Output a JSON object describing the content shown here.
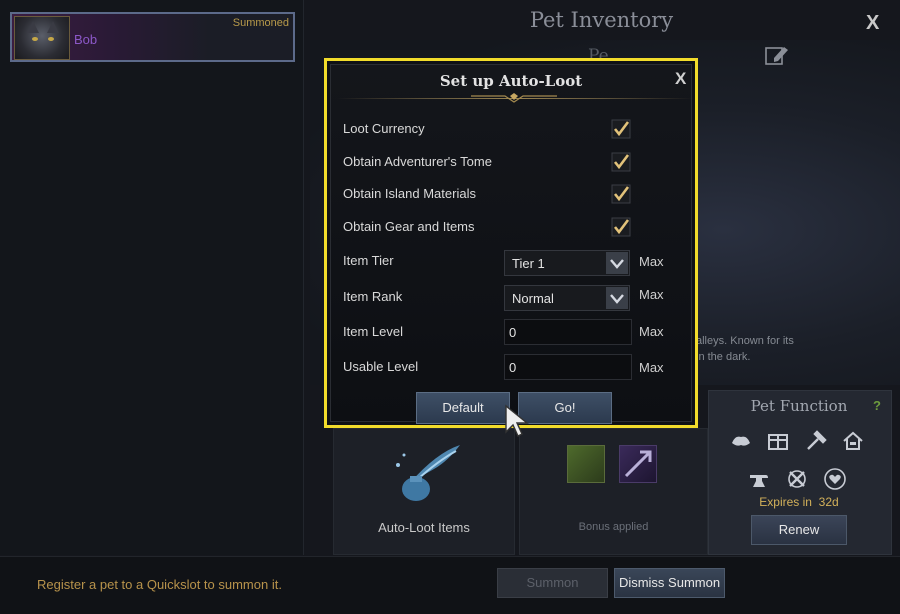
{
  "window": {
    "title": "Pet Inventory",
    "subtitle": "Pe",
    "close_glyph": "X"
  },
  "pet_list": [
    {
      "name": "Bob",
      "status": "Summoned"
    }
  ],
  "pet_description": "alleys. Known for its\nin the dark.",
  "dialog": {
    "title": "Set up Auto-Loot",
    "close_glyph": "X",
    "options": [
      {
        "label": "Loot Currency",
        "checked": true
      },
      {
        "label": "Obtain Adventurer's Tome",
        "checked": true
      },
      {
        "label": "Obtain Island Materials",
        "checked": true
      },
      {
        "label": "Obtain Gear and Items",
        "checked": true
      }
    ],
    "item_tier": {
      "label": "Item Tier",
      "value": "Tier 1",
      "max_label": "Max"
    },
    "item_rank": {
      "label": "Item Rank",
      "value": "Normal",
      "max_label": "Max"
    },
    "item_level": {
      "label": "Item Level",
      "value": "0",
      "max_label": "Max"
    },
    "usable_level": {
      "label": "Usable Level",
      "value": "0",
      "max_label": "Max"
    },
    "default_button": "Default",
    "go_button": "Go!"
  },
  "panels": {
    "auto_loot": {
      "label": "Auto-Loot Items",
      "icon": "auto-loot-bag-icon"
    },
    "bonus": {
      "label": "Bonus applied"
    },
    "pet_function": {
      "title": "Pet Function",
      "help_glyph": "?",
      "icons": [
        "storage-icon",
        "chest-icon",
        "hammer-icon",
        "home-icon",
        "anvil-icon",
        "repair-icon",
        "heart-icon"
      ],
      "expires_text": "Expires in  32d",
      "renew_button": "Renew"
    }
  },
  "footer": {
    "hint": "Register a pet to a Quickslot to summon it.",
    "summon_button": "Summon",
    "dismiss_button": "Dismiss Summon"
  },
  "colors": {
    "highlight": "#f2dc2b",
    "gold_text": "#b8934b",
    "check": "#e2c27a"
  }
}
